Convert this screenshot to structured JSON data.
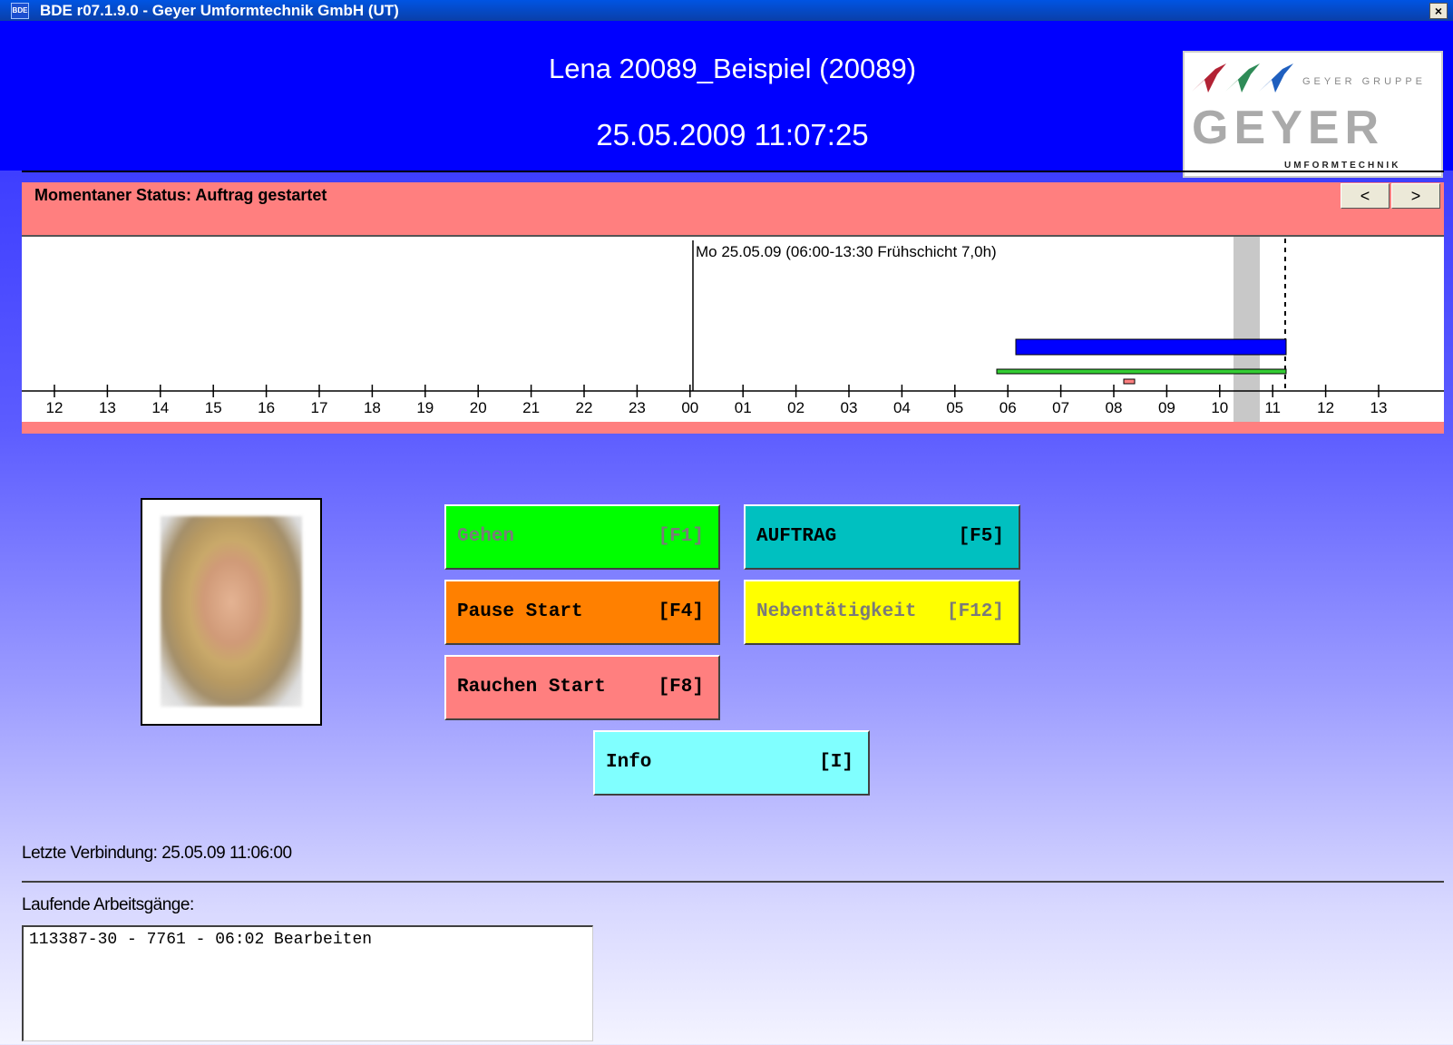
{
  "window": {
    "icon_label": "BDE",
    "title": "BDE r07.1.9.0 - Geyer Umformtechnik GmbH (UT)",
    "close_label": "×"
  },
  "header": {
    "user_name": "Lena 20089_Beispiel (20089)",
    "datetime": "25.05.2009 11:07:25",
    "logo": {
      "group_text": "GEYER GRUPPE",
      "brand_text": "GEYER",
      "sub_text": "UMFORMTECHNIK",
      "arrow_colors": [
        "#b22234",
        "#2e8b57",
        "#1f5fbf"
      ]
    }
  },
  "status": {
    "text": "Momentaner Status: Auftrag gestartet",
    "prev_label": "<",
    "next_label": ">",
    "color": "#ff7f7f"
  },
  "timeline": {
    "shift_label": "Mo 25.05.09  (06:00-13:30 Frühschicht 7,0h)",
    "hour_labels": [
      "12",
      "13",
      "14",
      "15",
      "16",
      "17",
      "18",
      "19",
      "20",
      "21",
      "22",
      "23",
      "00",
      "01",
      "02",
      "03",
      "04",
      "05",
      "06",
      "07",
      "08",
      "09",
      "10",
      "11",
      "12",
      "13"
    ],
    "work_bar_color": "#0000ff",
    "presence_bar_color": "#33cc33"
  },
  "buttons": {
    "gehen": {
      "label": "Gehen",
      "key": "[F1]",
      "enabled": false,
      "color": "#00ff00"
    },
    "auftrag": {
      "label": "AUFTRAG",
      "key": "[F5]",
      "enabled": true,
      "color": "#00c0c0"
    },
    "pause": {
      "label": "Pause Start",
      "key": "[F4]",
      "enabled": true,
      "color": "#ff8000"
    },
    "nebentaetigkeit": {
      "label": "Nebentätigkeit",
      "key": "[F12]",
      "enabled": false,
      "color": "#ffff00"
    },
    "rauchen": {
      "label": "Rauchen Start",
      "key": "[F8]",
      "enabled": true,
      "color": "#ff7f7f"
    },
    "info": {
      "label": "Info",
      "key": "[I]",
      "enabled": true,
      "color": "#80ffff"
    }
  },
  "footer": {
    "last_connection": "Letzte Verbindung: 25.05.09 11:06:00",
    "running_label": "Laufende Arbeitsgänge:",
    "running_items": [
      "113387-30 - 7761 - 06:02 Bearbeiten"
    ]
  }
}
